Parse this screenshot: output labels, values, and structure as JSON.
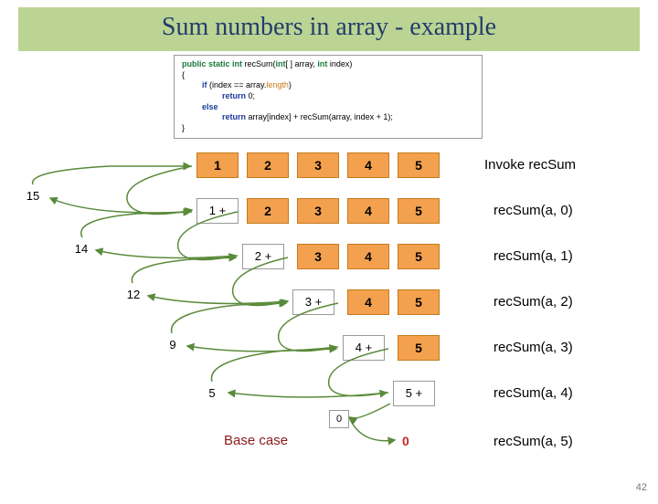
{
  "title": "Sum numbers in array - example",
  "code": {
    "sig_pre": "public static int ",
    "sig_name": "recSum(",
    "sig_arg1": "int",
    "sig_mid": "[ ] array, ",
    "sig_arg2": "int",
    "sig_end": " index)",
    "open": "{",
    "if_kw": "if ",
    "if_cond1": "(index == array.",
    "if_len": "length",
    "if_cond2": ")",
    "ret0_kw": "return ",
    "ret0_val": "0;",
    "else_kw": "else",
    "ret_kw": "return ",
    "ret_expr": "array[index] + recSum(array, index + 1);",
    "close": "}"
  },
  "rows": [
    {
      "cells": [
        "1",
        "2",
        "3",
        "4",
        "5"
      ],
      "label": "Invoke recSum"
    },
    {
      "plus": "1 +",
      "cells": [
        "2",
        "3",
        "4",
        "5"
      ],
      "label": "recSum(a, 0)"
    },
    {
      "plus": "2 +",
      "cells": [
        "3",
        "4",
        "5"
      ],
      "label": "recSum(a, 1)"
    },
    {
      "plus": "3 +",
      "cells": [
        "4",
        "5"
      ],
      "label": "recSum(a, 2)"
    },
    {
      "plus": "4 +",
      "cells": [
        "5"
      ],
      "label": "recSum(a, 3)"
    },
    {
      "plus": "5 +",
      "cells": [],
      "label": "recSum(a, 4)"
    },
    {
      "label": "recSum(a, 5)"
    }
  ],
  "sums": [
    "15",
    "14",
    "12",
    "9",
    "5"
  ],
  "zero_box": "0",
  "red_zero": "0",
  "base_case": "Base case",
  "slide_number": "42"
}
